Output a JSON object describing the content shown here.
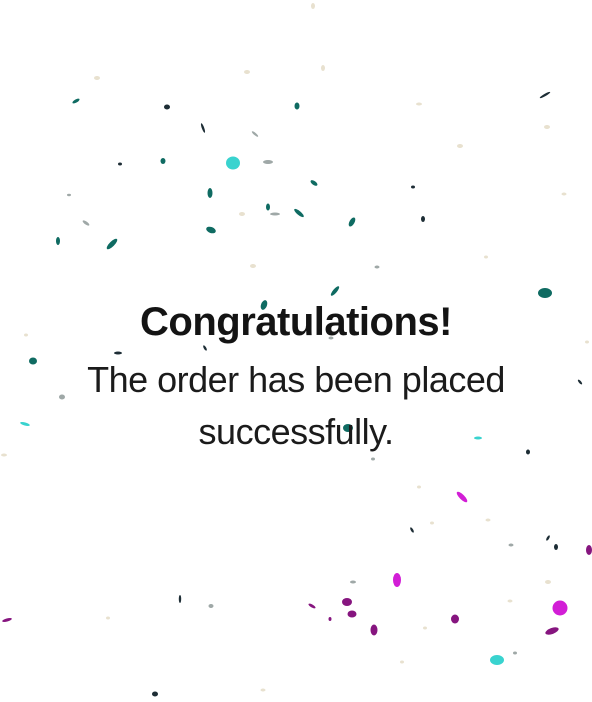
{
  "confirmation": {
    "headline": "Congratulations!",
    "message": "The order has been placed successfully."
  },
  "confetti": {
    "colors": {
      "teal": "#0f6b62",
      "cyan": "#39d3cf",
      "magenta": "#d21ed6",
      "purple": "#86157f",
      "dark": "#1d2d35",
      "pale": "#e8e1cf"
    }
  }
}
